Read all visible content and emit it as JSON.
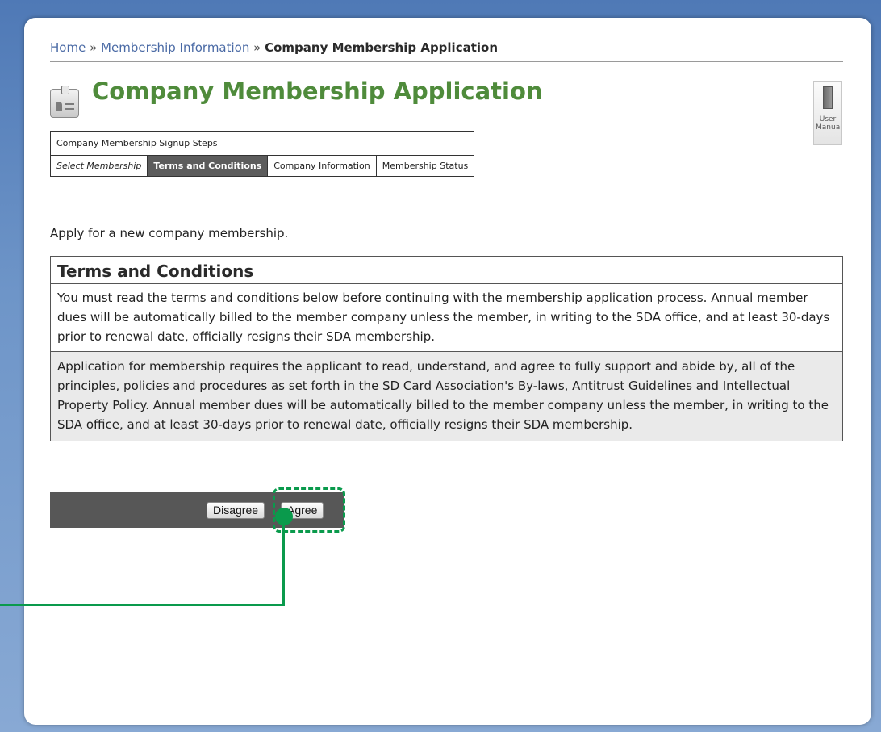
{
  "breadcrumb": {
    "home": "Home",
    "separator": "»",
    "membership_info": "Membership Information",
    "current": "Company Membership Application"
  },
  "page": {
    "title": "Company Membership Application",
    "title_color": "#4f8b3b",
    "title_icon": "id-card-icon"
  },
  "manual": {
    "label": "User Manual",
    "icon": "book-icon"
  },
  "steps": {
    "heading": "Company Membership Signup Steps",
    "items": [
      {
        "label": "Select Membership",
        "state": "done"
      },
      {
        "label": "Terms and Conditions",
        "state": "active"
      },
      {
        "label": "Company Information",
        "state": "pending"
      },
      {
        "label": "Membership Status",
        "state": "pending"
      }
    ]
  },
  "intro": "Apply for a new company membership.",
  "terms": {
    "title": "Terms and Conditions",
    "note": "You must read the terms and conditions below before continuing with the membership application process. Annual member dues will be automatically billed to the member company unless the member, in writing to the SDA office, and at least 30-days prior to renewal date, officially resigns their SDA membership.",
    "body": "Application for membership requires the applicant to read, understand, and agree to fully support and abide by, all of the principles, policies and procedures as set forth in the SD Card Association's By-laws, Antitrust Guidelines and Intellectual Property Policy. Annual member dues will be automatically billed to the member company unless the member, in writing to the SDA office, and at least 30-days prior to renewal date, officially resigns their SDA membership."
  },
  "actions": {
    "disagree": "Disagree",
    "agree": "Agree"
  },
  "annotation": {
    "color": "#0a9a4c",
    "target": "agree-button"
  }
}
